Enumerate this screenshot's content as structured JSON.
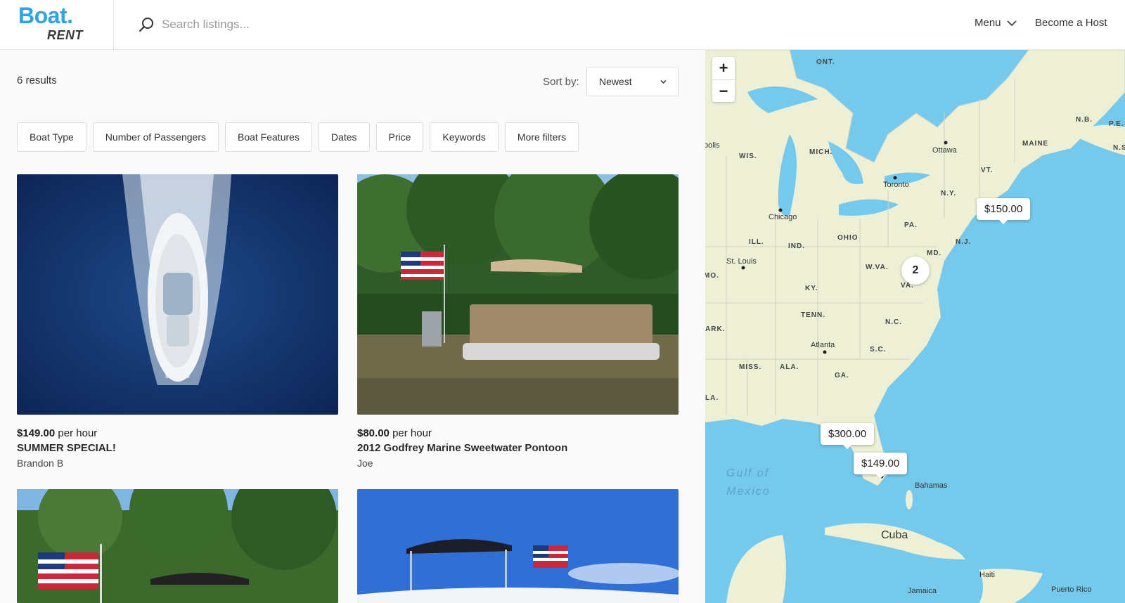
{
  "header": {
    "logo_top": "Boat.",
    "logo_bottom": "RENT",
    "search_placeholder": "Search listings...",
    "menu_label": "Menu",
    "host_label": "Become a Host"
  },
  "results": {
    "count_label": "6 results",
    "sort_label": "Sort by:",
    "sort_value": "Newest"
  },
  "filters": [
    "Boat Type",
    "Number of Passengers",
    "Boat Features",
    "Dates",
    "Price",
    "Keywords",
    "More filters"
  ],
  "listings": [
    {
      "price": "$149.00",
      "unit": "per hour",
      "title": "SUMMER SPECIAL!",
      "host": "Brandon B"
    },
    {
      "price": "$80.00",
      "unit": "per hour",
      "title": "2012 Godfrey Marine Sweetwater Pontoon",
      "host": "Joe"
    },
    {
      "price": "",
      "unit": "",
      "title": "",
      "host": ""
    },
    {
      "price": "",
      "unit": "",
      "title": "",
      "host": ""
    }
  ],
  "map": {
    "zoom_in": "+",
    "zoom_out": "−",
    "pins": [
      "$150.00",
      "$300.00",
      "$149.00"
    ],
    "cluster": "2",
    "labels": {
      "ont": "ONT.",
      "wis": "WIS.",
      "mich": "MICH.",
      "ny": "N.Y.",
      "vt": "VT.",
      "maine": "MAINE",
      "nb": "N.B.",
      "pe": "P.E.",
      "ns": "N.S",
      "pa": "PA.",
      "nj": "N.J.",
      "md": "MD.",
      "ohio": "OHIO",
      "ind": "IND.",
      "ill": "ILL.",
      "wva": "W.VA.",
      "va": "VA.",
      "ky": "KY.",
      "mo": "MO.",
      "tenn": "TENN.",
      "nc": "N.C.",
      "ark": "ARK.",
      "sc": "S.C.",
      "miss": "MISS.",
      "ala": "ALA.",
      "ga": "GA.",
      "la": "LA."
    },
    "cities": {
      "polis": "polis",
      "ottawa": "Ottawa",
      "toronto": "Toronto",
      "chicago": "Chicago",
      "stlouis": "St. Louis",
      "atlanta": "Atlanta",
      "bahamas": "Bahamas",
      "cuba": "Cuba",
      "haiti": "Haiti",
      "jamaica": "Jamaica",
      "puertorico": "Puerto Rico"
    },
    "water_line1": "Gulf of",
    "water_line2": "Mexico"
  }
}
